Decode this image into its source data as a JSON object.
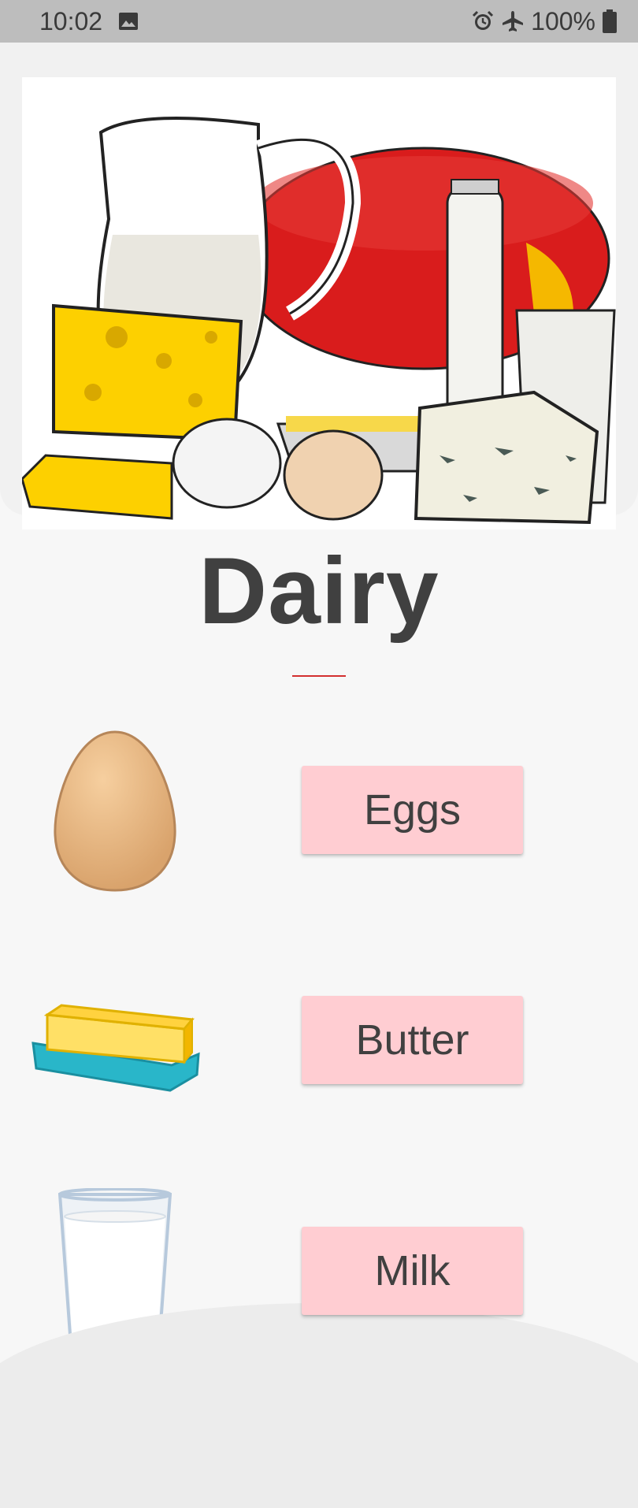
{
  "status_bar": {
    "time": "10:02",
    "battery_percent": "100%",
    "icons": [
      "image-icon",
      "alarm-icon",
      "airplane-mode-icon",
      "battery-icon"
    ]
  },
  "hero": {
    "image_name": "dairy-products-illustration"
  },
  "page": {
    "title": "Dairy",
    "accent_color": "#d32f2f",
    "button_color": "#ffcdd2"
  },
  "items": [
    {
      "label": "Eggs",
      "icon": "egg-icon"
    },
    {
      "label": "Butter",
      "icon": "butter-icon"
    },
    {
      "label": "Milk",
      "icon": "milk-glass-icon"
    }
  ]
}
